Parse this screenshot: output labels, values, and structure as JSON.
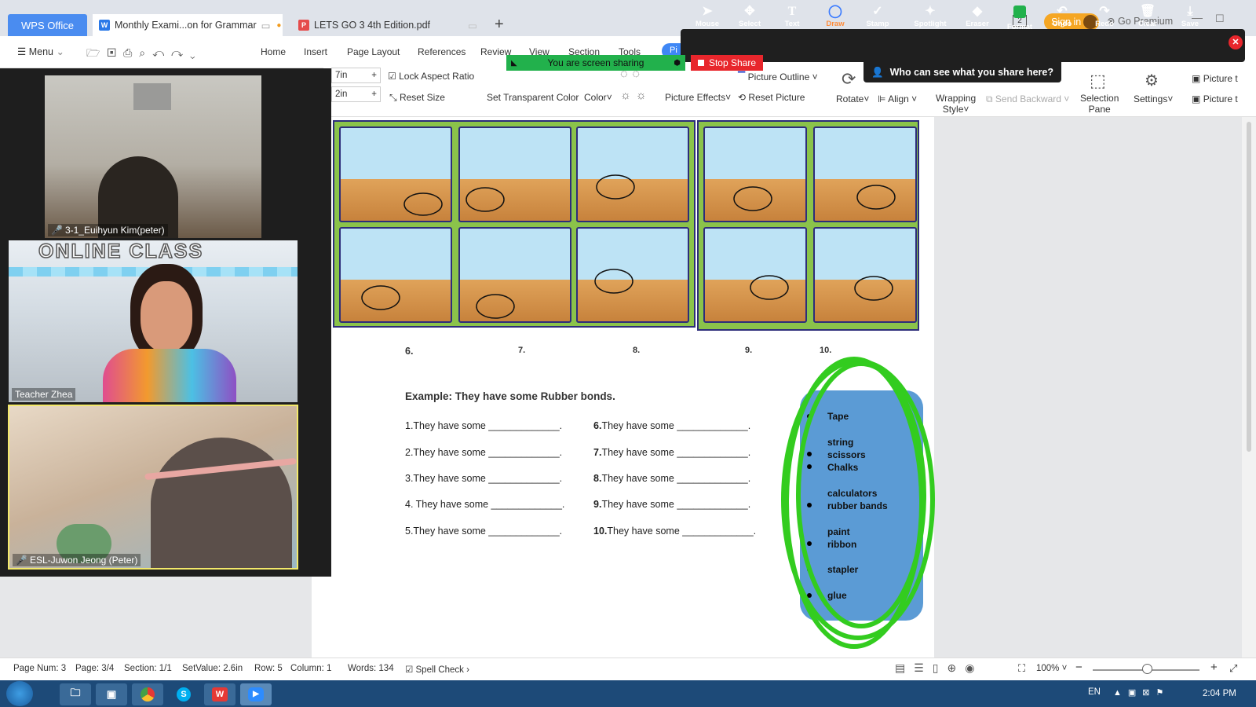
{
  "tabs": {
    "app": "WPS Office",
    "doc1": "Monthly  Exami...on for Grammar",
    "doc2": "LETS GO 3 4th Edition.pdf",
    "new_tab": "+"
  },
  "window": {
    "sign_in": "Sign in",
    "go_premium": "Go Premium",
    "badge": "2"
  },
  "menu": {
    "menu_label": "Menu",
    "items": [
      "Home",
      "Insert",
      "Page Layout",
      "References",
      "Review",
      "View",
      "Section",
      "Tools"
    ],
    "pic_tab": "Pi"
  },
  "ribbon": {
    "width_value": "7in",
    "height_value": "2in",
    "lock_aspect": "Lock Aspect Ratio",
    "reset_size": "Reset Size",
    "set_transparent": "Set Transparent Color",
    "color": "Color",
    "picture_effects": "Picture Effects",
    "picture_outline": "Picture Outline",
    "reset_picture": "Reset Picture",
    "rotate": "Rotate",
    "align": "Align",
    "wrapping_line1": "Wrapping",
    "wrapping_line2": "Style",
    "send_backward": "Send Backward",
    "selection_line1": "Selection",
    "selection_line2": "Pane",
    "settings": "Settings",
    "picture_t1": "Picture t",
    "picture_t2": "Picture t"
  },
  "share": {
    "banner": "You are screen sharing",
    "stop": "Stop Share",
    "who_can_see": "Who can see what you share here?",
    "tools": [
      {
        "label": "Mouse",
        "icon": "pointer-icon"
      },
      {
        "label": "Select",
        "icon": "move-icon"
      },
      {
        "label": "Text",
        "icon": "text-icon"
      },
      {
        "label": "Draw",
        "icon": "draw-icon"
      },
      {
        "label": "Stamp",
        "icon": "stamp-icon"
      },
      {
        "label": "Spotlight",
        "icon": "spotlight-icon"
      },
      {
        "label": "Eraser",
        "icon": "eraser-icon"
      },
      {
        "label": "Format",
        "icon": "format-icon"
      },
      {
        "label": "Undo",
        "icon": "undo-icon"
      },
      {
        "label": "Redo",
        "icon": "redo-icon"
      },
      {
        "label": "Clear",
        "icon": "clear-icon"
      },
      {
        "label": "Save",
        "icon": "save-icon"
      }
    ],
    "accent": "#22b14c",
    "stop_color": "#e8262c"
  },
  "participants": [
    {
      "name": "3-1_Euihyun Kim(peter)"
    },
    {
      "name": "Teacher Zhea",
      "banner": "ONLINE CLASS"
    },
    {
      "name": "ESL-Juwon Jeong (Peter)"
    }
  ],
  "worksheet": {
    "numbers": [
      "6.",
      "7.",
      "8.",
      "9.",
      "10."
    ],
    "example": "Example: They have some Rubber bonds.",
    "lines_left": [
      "1.They have some _____________.",
      "2.They have some _____________.",
      "3.They have some _____________.",
      "4. They have some _____________.",
      "5.They have some _____________."
    ],
    "lines_right_nums": [
      "6.",
      "7.",
      "8.",
      "9.",
      "10."
    ],
    "lines_right_text": [
      "They have some  _____________.",
      "They have some  _____________.",
      "They have some  _____________.",
      "They have some  _____________.",
      "They have some  _____________."
    ],
    "word_bank": [
      "Tape",
      "string",
      "scissors",
      "Chalks",
      "calculators",
      "rubber bands",
      "paint",
      "ribbon",
      "stapler",
      "glue"
    ]
  },
  "status": {
    "page_num": "Page Num: 3",
    "page": "Page: 3/4",
    "section": "Section: 1/1",
    "set_value": "SetValue: 2.6in",
    "row": "Row: 5",
    "column": "Column: 1",
    "words": "Words: 134",
    "spell_check": "Spell Check",
    "zoom": "100%"
  },
  "taskbar": {
    "lang": "EN",
    "time": "2:04 PM"
  }
}
